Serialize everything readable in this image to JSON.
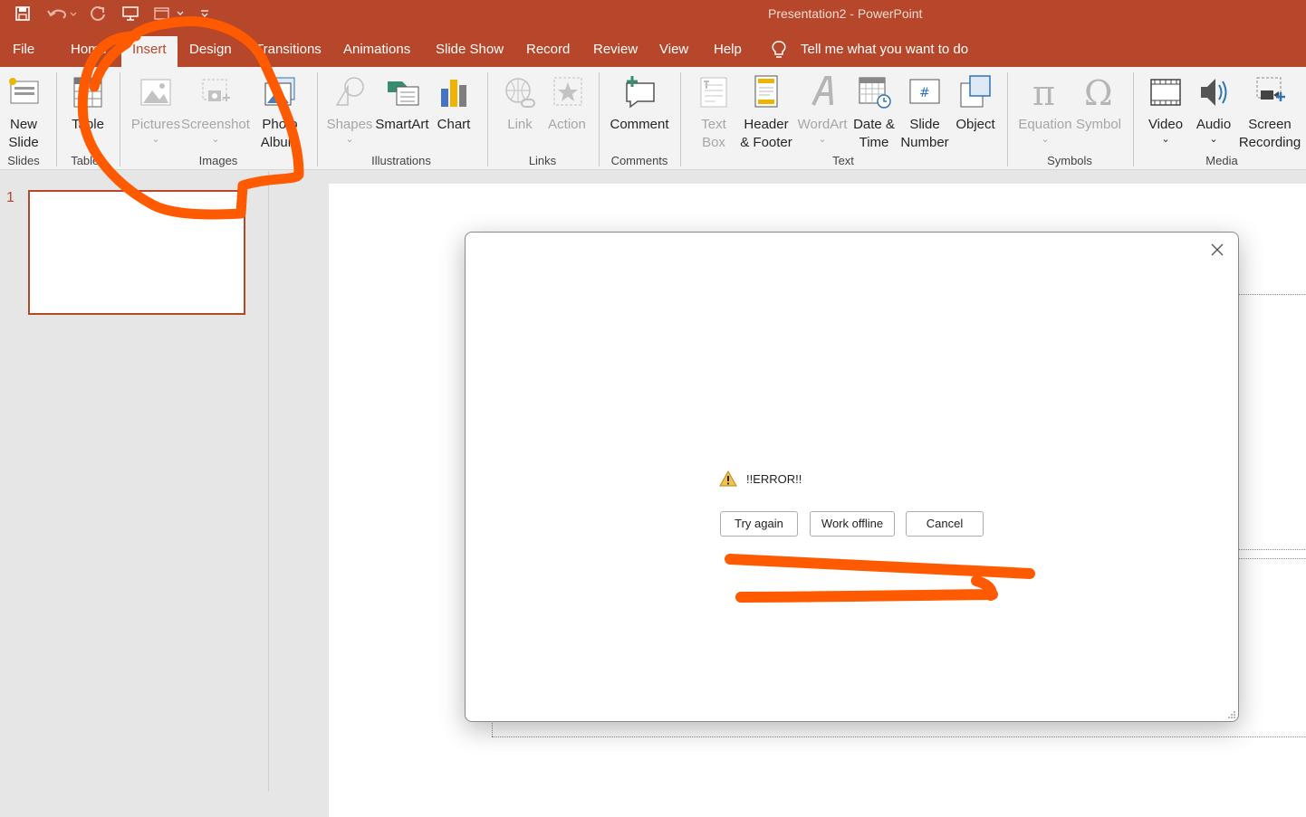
{
  "window": {
    "title": "Presentation2  -  PowerPoint"
  },
  "quick_access": [
    {
      "icon": "save-icon"
    },
    {
      "icon": "undo-icon"
    },
    {
      "icon": "redo-icon"
    },
    {
      "icon": "present-from-beginning-icon"
    },
    {
      "icon": "slide-layout-icon"
    },
    {
      "icon": "customize-toolbar-icon"
    }
  ],
  "tabs": [
    "File",
    "Home",
    "Insert",
    "Design",
    "Transitions",
    "Animations",
    "Slide Show",
    "Record",
    "Review",
    "View",
    "Help"
  ],
  "active_tab": "Insert",
  "tell_me": "Tell me what you want to do",
  "ribbon": {
    "new_slide": "New Slide",
    "table": "Table",
    "pictures": "Pictures",
    "screenshot": "Screenshot",
    "photo_album": "Photo Album",
    "shapes": "Shapes",
    "smartart": "SmartArt",
    "chart": "Chart",
    "link": "Link",
    "action": "Action",
    "comment": "Comment",
    "text_box": "Text Box",
    "header_footer": "Header & Footer",
    "wordart": "WordArt",
    "date_time": "Date & Time",
    "slide_number": "Slide Number",
    "object": "Object",
    "equation": "Equation",
    "symbol": "Symbol",
    "video": "Video",
    "audio": "Audio",
    "screen_recording": "Screen Recording"
  },
  "groups": {
    "slides": "Slides",
    "tables": "Tables",
    "images": "Images",
    "illustrations": "Illustrations",
    "links": "Links",
    "comments": "Comments",
    "text": "Text",
    "symbols": "Symbols",
    "media": "Media"
  },
  "slides_panel": {
    "slide_number": "1"
  },
  "dialog": {
    "message": "!!ERROR!!",
    "try_again": "Try again",
    "work_offline": "Work offline",
    "cancel": "Cancel"
  },
  "colors": {
    "accent": "#b7472a",
    "annotation": "#ff5a00"
  }
}
